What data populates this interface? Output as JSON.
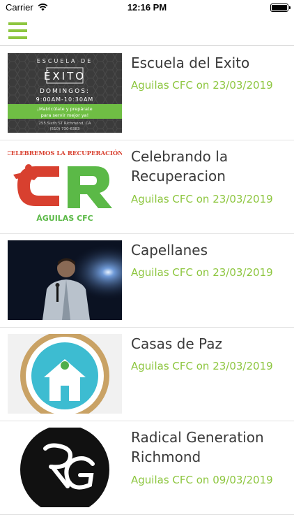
{
  "status_bar": {
    "carrier": "Carrier",
    "time": "12:16 PM",
    "battery_level": 1.0
  },
  "nav": {
    "menu_icon": "hamburger-menu-icon"
  },
  "accent_color": "#8dc63f",
  "items": [
    {
      "title": "Escuela del Exito",
      "meta": "Aguilas CFC on 23/03/2019",
      "thumb": {
        "line1": "ESCUELA DE",
        "line2": "ÉXITO",
        "line3": "DOMINGOS:",
        "line4": "9:00AM-10:30AM",
        "line5": "¡Matricúlate y prepárate",
        "line6": "para servir mejor ya!",
        "line7": "255 Sixth ST Richmond, CA",
        "line8": "(510) 730-6383"
      }
    },
    {
      "title": "Celebrando la Recuperacion",
      "meta": "Aguilas CFC on 23/03/2019",
      "thumb": {
        "top": "CELEBREMOS LA RECUPERACIÓN",
        "bottom": "ÁGUILAS CFC"
      }
    },
    {
      "title": "Capellanes",
      "meta": "Aguilas CFC on 23/03/2019"
    },
    {
      "title": "Casas de Paz",
      "meta": "Aguilas CFC on 23/03/2019"
    },
    {
      "title": "Radical Generation Richmond",
      "meta": "Aguilas CFC on 09/03/2019"
    }
  ]
}
